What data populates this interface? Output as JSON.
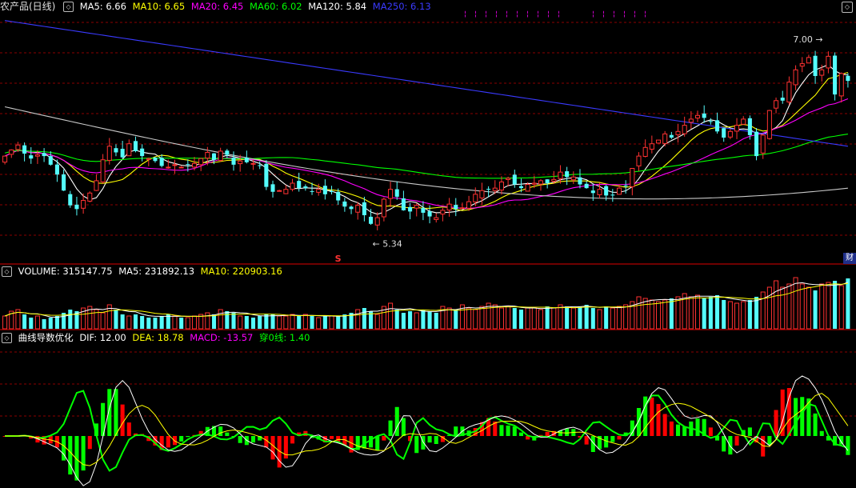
{
  "colors": {
    "up": "#ff3232",
    "down": "#54fcfc",
    "ma5": "#ffffff",
    "ma10": "#ffff00",
    "ma20": "#ff00ff",
    "ma60": "#00ff00",
    "ma120": "#c8c8c8",
    "ma250": "#3a3aff",
    "grid": "#8b0000"
  },
  "price_panel": {
    "title": "农产品(日线)",
    "indicators": [
      {
        "label": "MA5: 6.66",
        "color": "#ffffff"
      },
      {
        "label": "MA10: 6.65",
        "color": "#ffff00"
      },
      {
        "label": "MA20: 6.45",
        "color": "#ff00ff"
      },
      {
        "label": "MA60: 6.02",
        "color": "#00ff00"
      },
      {
        "label": "MA120: 5.84",
        "color": "#ffffff"
      },
      {
        "label": "MA250: 6.13",
        "color": "#3a3aff"
      }
    ],
    "high_label": "7.00",
    "low_label": "5.34",
    "marker_s": "S",
    "tag_cai": "财"
  },
  "volume_panel": {
    "indicators": [
      {
        "label": "VOLUME: 315147.75",
        "color": "#ffffff"
      },
      {
        "label": "MA5: 231892.13",
        "color": "#ffffff"
      },
      {
        "label": "MA10: 220903.16",
        "color": "#ffff00"
      }
    ]
  },
  "macd_panel": {
    "indicators": [
      {
        "label": "曲线导数优化",
        "color": "#ffffff"
      },
      {
        "label": "DIF: 12.00",
        "color": "#ffffff"
      },
      {
        "label": "DEA: 18.78",
        "color": "#ffff00"
      },
      {
        "label": "MACD: -13.57",
        "color": "#ff00ff"
      },
      {
        "label": "穿0线: 1.40",
        "color": "#00ff00"
      }
    ]
  },
  "chart_data": [
    {
      "type": "candlestick",
      "title": "农产品(日线)",
      "high": 7.0,
      "low": 5.34,
      "price_range": [
        5.2,
        7.2
      ],
      "closes": [
        6.05,
        6.1,
        6.14,
        6.07,
        6.03,
        6.06,
        6.05,
        5.98,
        5.9,
        5.77,
        5.65,
        5.62,
        5.69,
        5.75,
        5.85,
        6.02,
        6.13,
        6.08,
        6.04,
        6.15,
        6.09,
        6.05,
        6.03,
        6.01,
        5.97,
        5.96,
        5.98,
        5.96,
        5.98,
        5.99,
        6.03,
        6.08,
        6.02,
        6.09,
        6.06,
        5.98,
        6.01,
        6.0,
        5.99,
        5.97,
        5.8,
        5.76,
        5.77,
        5.78,
        5.83,
        5.79,
        5.79,
        5.76,
        5.78,
        5.74,
        5.76,
        5.69,
        5.64,
        5.62,
        5.65,
        5.57,
        5.5,
        5.55,
        5.7,
        5.78,
        5.72,
        5.61,
        5.6,
        5.65,
        5.59,
        5.56,
        5.55,
        5.61,
        5.66,
        5.62,
        5.63,
        5.68,
        5.74,
        5.77,
        5.78,
        5.79,
        5.84,
        5.87,
        5.82,
        5.79,
        5.82,
        5.83,
        5.85,
        5.83,
        5.86,
        5.92,
        5.88,
        5.88,
        5.82,
        5.79,
        5.75,
        5.78,
        5.73,
        5.73,
        5.79,
        5.81,
        5.95,
        6.05,
        6.12,
        6.15,
        6.18,
        6.23,
        6.2,
        6.25,
        6.3,
        6.35,
        6.38,
        6.36,
        6.33,
        6.25,
        6.2,
        6.25,
        6.3,
        6.35,
        6.22,
        6.05,
        6.22,
        6.42,
        6.5,
        6.5,
        6.65,
        6.75,
        6.8,
        6.85,
        6.7,
        6.75,
        6.86,
        6.55,
        6.72,
        6.66
      ],
      "ma_last": {
        "MA5": 6.66,
        "MA10": 6.65,
        "MA20": 6.45,
        "MA60": 6.02,
        "MA120": 5.84,
        "MA250": 6.13
      }
    },
    {
      "type": "bar",
      "title": "VOLUME",
      "last": 315147.75,
      "ma5": 231892.13,
      "ma10": 220903.16,
      "values": [
        80,
        110,
        120,
        90,
        70,
        80,
        60,
        70,
        80,
        100,
        120,
        110,
        130,
        140,
        120,
        100,
        150,
        120,
        90,
        80,
        90,
        80,
        70,
        70,
        80,
        90,
        80,
        70,
        70,
        80,
        90,
        100,
        90,
        120,
        110,
        100,
        80,
        80,
        70,
        80,
        90,
        90,
        80,
        80,
        90,
        80,
        90,
        80,
        70,
        80,
        80,
        80,
        90,
        100,
        120,
        130,
        110,
        90,
        140,
        160,
        120,
        100,
        110,
        100,
        120,
        110,
        100,
        140,
        130,
        120,
        150,
        130,
        120,
        140,
        160,
        150,
        130,
        140,
        130,
        120,
        130,
        130,
        120,
        140,
        130,
        150,
        140,
        130,
        140,
        150,
        130,
        120,
        140,
        130,
        140,
        150,
        170,
        200,
        190,
        180,
        170,
        180,
        190,
        200,
        220,
        200,
        210,
        190,
        200,
        210,
        180,
        170,
        160,
        170,
        180,
        200,
        230,
        260,
        300,
        260,
        280,
        320,
        280,
        260,
        240,
        280,
        290,
        300,
        270,
        315
      ]
    },
    {
      "type": "line",
      "title": "曲线导数优化",
      "series": [
        {
          "name": "DIF",
          "last": 12.0
        },
        {
          "name": "DEA",
          "last": 18.78
        },
        {
          "name": "MACD",
          "last": -13.57
        },
        {
          "name": "穿0线",
          "last": 1.4
        }
      ]
    }
  ]
}
